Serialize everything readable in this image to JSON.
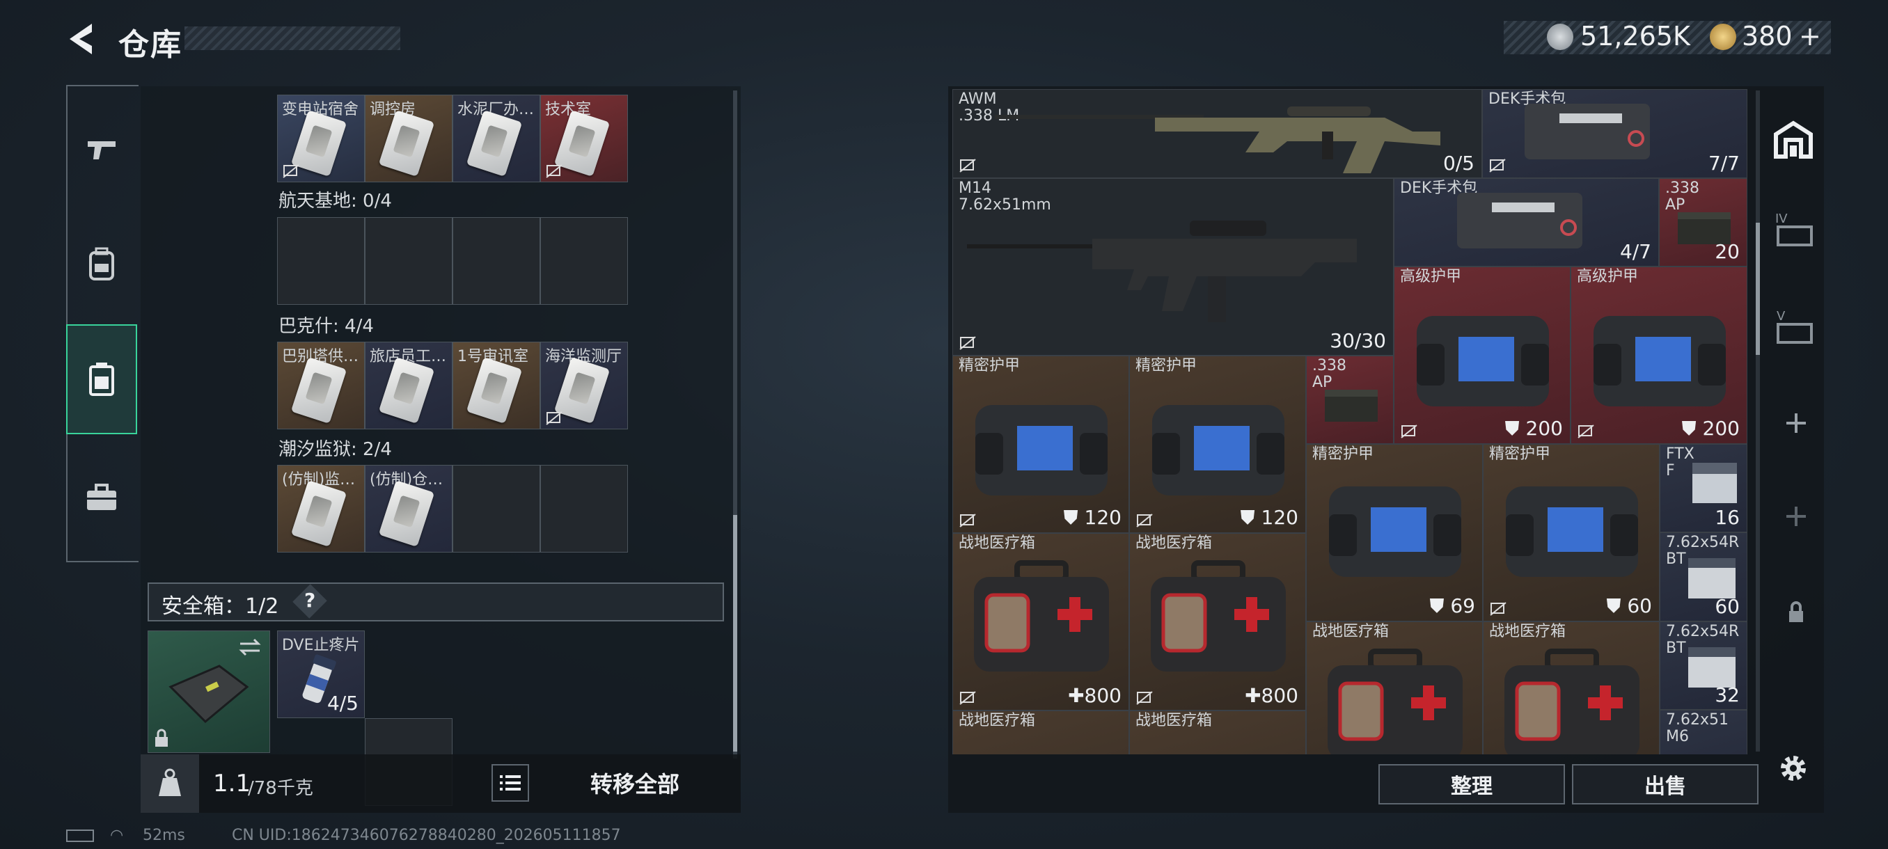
{
  "header": {
    "title": "仓库",
    "currency_silver": "51,265K",
    "currency_gold": "380",
    "gold_add": "+"
  },
  "sidebar": {
    "items": [
      {
        "name": "weapons",
        "icon": "pistol-icon"
      },
      {
        "name": "gear",
        "icon": "backpack-icon"
      },
      {
        "name": "keys",
        "icon": "keycard-case-icon",
        "active": true
      },
      {
        "name": "case",
        "icon": "briefcase-icon"
      }
    ]
  },
  "keycards": {
    "row0": [
      "变电站宿舍",
      "调控房",
      "水泥厂办…",
      "技术室"
    ],
    "section_aerospace": "航天基地: 0/4",
    "section_bakesh": "巴克什: 4/4",
    "row_bakesh": [
      "巴别塔供…",
      "旅店员工…",
      "1号审讯室",
      "海洋监测厅"
    ],
    "section_tide": "潮汐监狱: 2/4",
    "row_tide": [
      "(仿制)监…",
      "(仿制)仓…"
    ]
  },
  "safebox": {
    "label": "安全箱：1/2",
    "help": "?",
    "item_name": "DVE止疼片",
    "item_count": "4/5"
  },
  "bottom": {
    "weight_value": "1.1",
    "weight_unit": "/78千克",
    "transfer_all": "转移全部"
  },
  "stash": {
    "awm_name": "AWM\n.338 LM",
    "awm_count": "0/5",
    "dek1_name": "DEK手术包",
    "dek1_count": "7/7",
    "m14_name": "M14\n7.62x51mm",
    "m14_count": "30/30",
    "dek2_name": "DEK手术包",
    "dek2_count": "4/7",
    "ap338_name": ".338\nAP",
    "ap338_count": "20",
    "adv_armor": "高级护甲",
    "adv_armor_dur1": "200",
    "adv_armor_dur2": "200",
    "precise_armor": "精密护甲",
    "pa_dur1": "120",
    "pa_dur2": "120",
    "pa_dur3": "69",
    "pa_dur4": "60",
    "ap338b_name": ".338\nAP",
    "ftx_name": "FTX\nF",
    "ftx_count": "16",
    "r762a_name": "7.62x54R\nBT",
    "r762a_count": "60",
    "r762b_name": "7.62x54R\nBT",
    "r762b_count": "32",
    "r76251_name": "7.62x51\nM6",
    "medkit": "战地医疗箱",
    "med_dur1": "800",
    "med_dur2": "800"
  },
  "actions": {
    "sort": "整理",
    "sell": "出售"
  },
  "status": {
    "ping": "52ms",
    "uid": "CN UID:18624734607627884028​0_202605111857"
  }
}
